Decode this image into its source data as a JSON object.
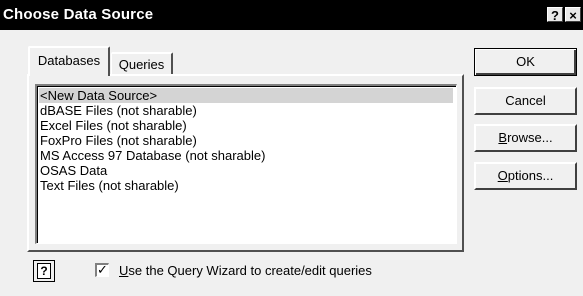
{
  "window": {
    "title": "Choose Data Source",
    "help_glyph": "?",
    "close_glyph": "×"
  },
  "tabs": [
    {
      "label": "Databases",
      "active": true
    },
    {
      "label": "Queries",
      "active": false
    }
  ],
  "data_sources": {
    "items": [
      {
        "label": "<New Data Source>",
        "selected": true
      },
      {
        "label": "dBASE Files (not sharable)",
        "selected": false
      },
      {
        "label": "Excel Files (not sharable)",
        "selected": false
      },
      {
        "label": "FoxPro Files (not sharable)",
        "selected": false
      },
      {
        "label": "MS Access 97 Database (not sharable)",
        "selected": false
      },
      {
        "label": "OSAS Data",
        "selected": false
      },
      {
        "label": "Text Files (not sharable)",
        "selected": false
      }
    ]
  },
  "buttons": {
    "ok": "OK",
    "cancel": "Cancel",
    "browse_mnemonic": "B",
    "browse_rest": "rowse...",
    "options_mnemonic": "O",
    "options_rest": "ptions..."
  },
  "footer": {
    "help_icon": "help-book-icon",
    "help_glyph": "?",
    "wizard_checkbox_checked": true,
    "wizard_check_glyph": "✓",
    "wizard_label_mnemonic": "U",
    "wizard_label_rest": "se the Query Wizard to create/edit queries"
  }
}
